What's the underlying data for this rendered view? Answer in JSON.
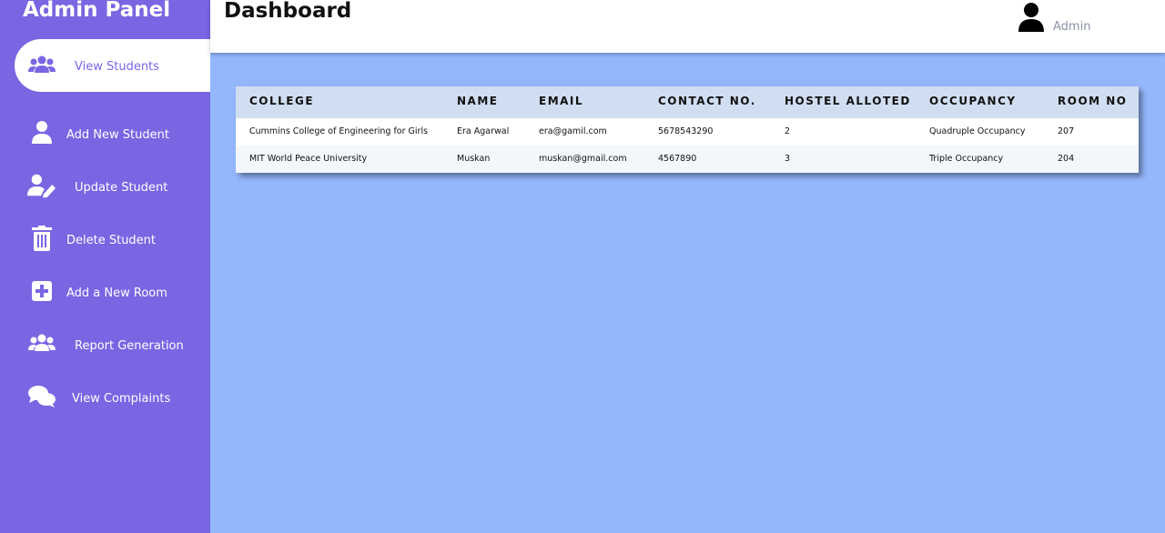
{
  "sidebar": {
    "brand": "Admin Panel",
    "items": [
      {
        "label": "View Students",
        "icon": "users-icon"
      },
      {
        "label": "Add New Student",
        "icon": "user-icon"
      },
      {
        "label": "Update Student",
        "icon": "user-edit-icon"
      },
      {
        "label": "Delete Student",
        "icon": "trash-icon"
      },
      {
        "label": "Add a New Room",
        "icon": "plus-square-icon"
      },
      {
        "label": "Report Generation",
        "icon": "users-icon"
      },
      {
        "label": "View Complaints",
        "icon": "comments-icon"
      }
    ]
  },
  "header": {
    "title": "Dashboard",
    "user": "Admin"
  },
  "table": {
    "columns": [
      "COLLEGE",
      "NAME",
      "EMAIL",
      "CONTACT NO.",
      "HOSTEL ALLOTED",
      "OCCUPANCY",
      "ROOM NO"
    ],
    "rows": [
      [
        "Cummins College of Engineering for Girls",
        "Era Agarwal",
        "era@gamil.com",
        "5678543290",
        "2",
        "Quadruple Occupancy",
        "207"
      ],
      [
        "MIT World Peace University",
        "Muskan",
        "muskan@gmail.com",
        "4567890",
        "3",
        "Triple Occupancy",
        "204"
      ]
    ]
  },
  "colors": {
    "sidebar": "#7866e2",
    "background": "#94b7fc",
    "table_header": "#d1def1"
  }
}
